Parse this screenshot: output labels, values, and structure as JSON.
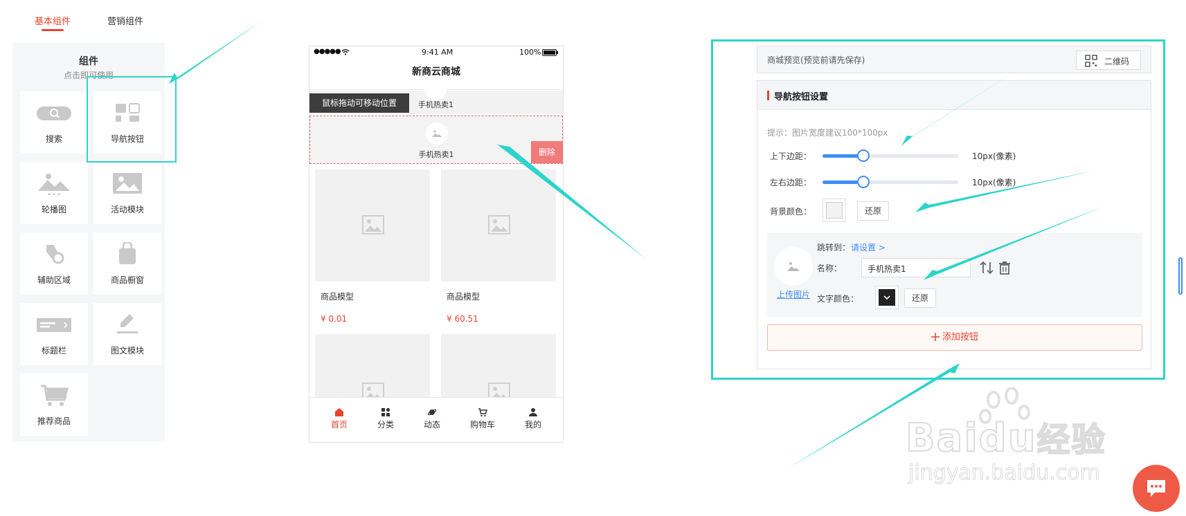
{
  "tabs": [
    {
      "label": "基本组件",
      "active": true
    },
    {
      "label": "营销组件",
      "active": false
    }
  ],
  "components_panel": {
    "title": "组件",
    "subtitle": "点击即可使用",
    "items": [
      {
        "label": "搜索",
        "icon": "search-icon"
      },
      {
        "label": "导航按钮",
        "icon": "nav-button-icon"
      },
      {
        "label": "轮播图",
        "icon": "carousel-icon"
      },
      {
        "label": "活动模块",
        "icon": "image-icon"
      },
      {
        "label": "辅助区域",
        "icon": "tools-icon"
      },
      {
        "label": "商品橱窗",
        "icon": "shopping-bag-icon"
      },
      {
        "label": "标题栏",
        "icon": "title-bar-icon"
      },
      {
        "label": "图文模块",
        "icon": "edit-icon"
      },
      {
        "label": "推荐商品",
        "icon": "cart-icon"
      }
    ]
  },
  "phone": {
    "status_dots": "●●●●●",
    "status_time": "9:41 AM",
    "status_battery": "100%",
    "title": "新商云商城",
    "drag_tip": "鼠标拖动可移动位置",
    "nav_label_top": "手机热卖1",
    "nav_label_selected": "手机热卖1",
    "delete_label": "删除",
    "products": [
      {
        "name": "商品模型",
        "price": "¥ 0.01"
      },
      {
        "name": "商品模型",
        "price": "¥ 60.51"
      }
    ],
    "tabbar": [
      {
        "label": "首页",
        "icon": "home-icon",
        "active": true
      },
      {
        "label": "分类",
        "icon": "category-icon",
        "active": false
      },
      {
        "label": "动态",
        "icon": "planet-icon",
        "active": false
      },
      {
        "label": "购物车",
        "icon": "cart-icon",
        "active": false
      },
      {
        "label": "我的",
        "icon": "user-icon",
        "active": false
      }
    ]
  },
  "preview": {
    "label": "商城预览(预览前请先保存)",
    "qr_label": "二维码"
  },
  "settings": {
    "title": "导航按钮设置",
    "hint": "提示：图片宽度建议100*100px",
    "vertical_margin": {
      "label": "上下边距：",
      "value_text": "10px(像素)",
      "fraction": 0.3
    },
    "horizontal_margin": {
      "label": "左右边距：",
      "value_text": "10px(像素)",
      "fraction": 0.3
    },
    "bg_color": {
      "label": "背景颜色：",
      "restore": "还原"
    },
    "item": {
      "jump_label": "跳转到：",
      "jump_link": "请设置 >",
      "name_label": "名称：",
      "name_value": "手机热卖1",
      "text_color_label": "文字颜色：",
      "restore": "还原",
      "upload": "上传图片"
    },
    "add_button": "添加按钮"
  },
  "watermark": {
    "line1": "Bai",
    "line1b": "du",
    "line1c": "经验",
    "line2": "jingyan.baidu.com"
  },
  "colors": {
    "accent": "#e8432e",
    "highlight": "#2dd4c9",
    "link": "#3e8ef7"
  }
}
